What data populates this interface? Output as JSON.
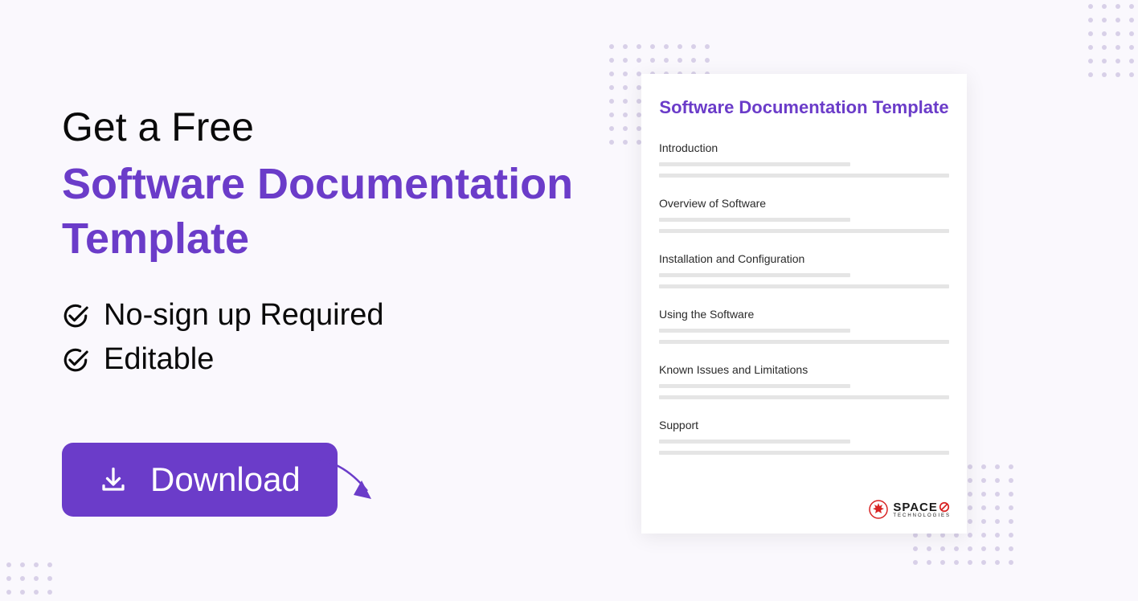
{
  "headline": {
    "pre": "Get a Free",
    "main": "Software Documentation Template"
  },
  "features": [
    "No-sign up Required",
    "Editable"
  ],
  "download_label": "Download",
  "preview": {
    "title": "Software Documentation Template",
    "sections": [
      "Introduction",
      "Overview of Software",
      "Installation and Configuration",
      "Using the Software",
      "Known Issues and Limitations",
      "Support"
    ],
    "logo": {
      "main": "SPACE",
      "sub": "TECHNOLOGIES"
    }
  },
  "colors": {
    "accent": "#6b3cc9",
    "bg": "#faf8fd"
  }
}
